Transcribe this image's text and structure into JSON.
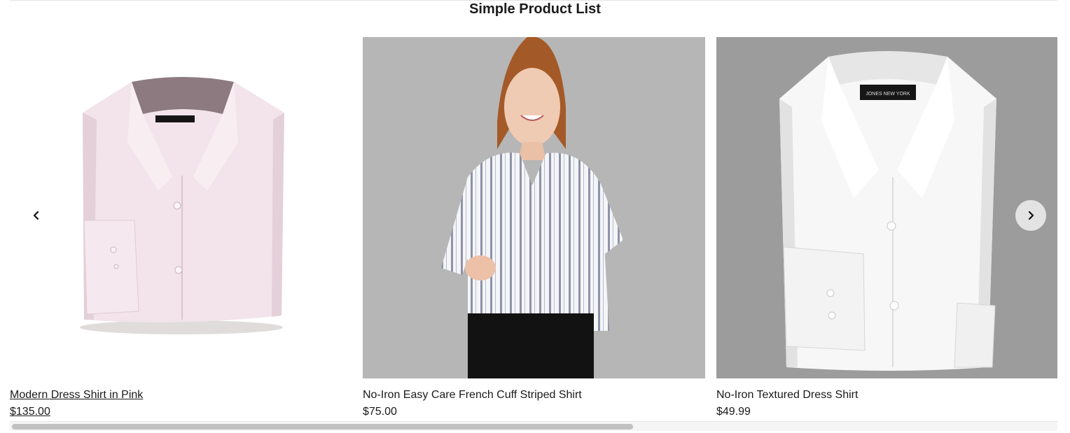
{
  "page": {
    "title": "Simple Product List"
  },
  "carousel": {
    "prev_icon": "chevron-left-icon",
    "next_icon": "chevron-right-icon",
    "products": [
      {
        "name": "Modern Dress Shirt in Pink",
        "price": "$135.00",
        "image": "folded-pink-dress-shirt"
      },
      {
        "name": "No-Iron Easy Care French Cuff Striped Shirt",
        "price": "$75.00",
        "image": "model-in-striped-shirt"
      },
      {
        "name": "No-Iron Textured Dress Shirt",
        "price": "$49.99",
        "image": "folded-white-dress-shirt"
      }
    ],
    "scroll_position": 0.0
  },
  "brand_label": "JONES NEW YORK",
  "colors": {
    "text": "#1a1a1a",
    "nav_button_bg": "#e3e3e3",
    "gray_backdrop": "#9c9c9c"
  }
}
